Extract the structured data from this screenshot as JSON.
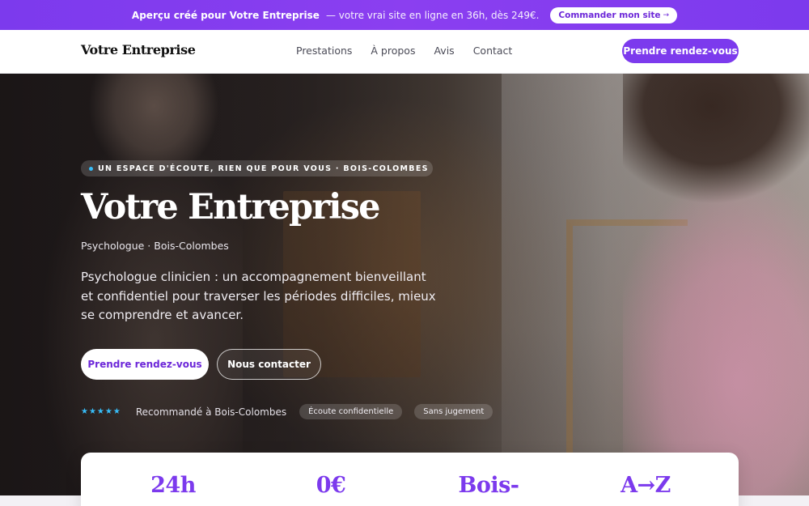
{
  "promo": {
    "strong": "Aperçu créé pour Votre Entreprise",
    "rest": "— votre vrai site en ligne en 36h, dès 249€.",
    "cta_label": "Commander mon site",
    "cta_arrow": "→"
  },
  "nav": {
    "brand": "Votre Entreprise",
    "links": [
      "Prestations",
      "À propos",
      "Avis",
      "Contact"
    ],
    "cta_label": "Prendre rendez-vous"
  },
  "hero": {
    "eyebrow": "UN ESPACE D'ÉCOUTE, RIEN QUE POUR VOUS · BOIS-COLOMBES",
    "title": "Votre Entreprise",
    "subtitle": "Psychologue · Bois-Colombes",
    "description": "Psychologue clinicien : un accompagnement bienveillant et confidentiel pour traverser les périodes difficiles, mieux se comprendre et avancer.",
    "primary_cta": "Prendre rendez-vous",
    "secondary_cta": "Nous contacter",
    "stars": "★★★★★",
    "trust_text": "Recommandé à Bois-Colombes",
    "pills": [
      "Écoute confidentielle",
      "Sans jugement"
    ]
  },
  "stats": [
    "24h",
    "0€",
    "Bois-",
    "A→Z"
  ],
  "colors": {
    "accent": "#7c3aed",
    "star": "#38bdf8"
  }
}
